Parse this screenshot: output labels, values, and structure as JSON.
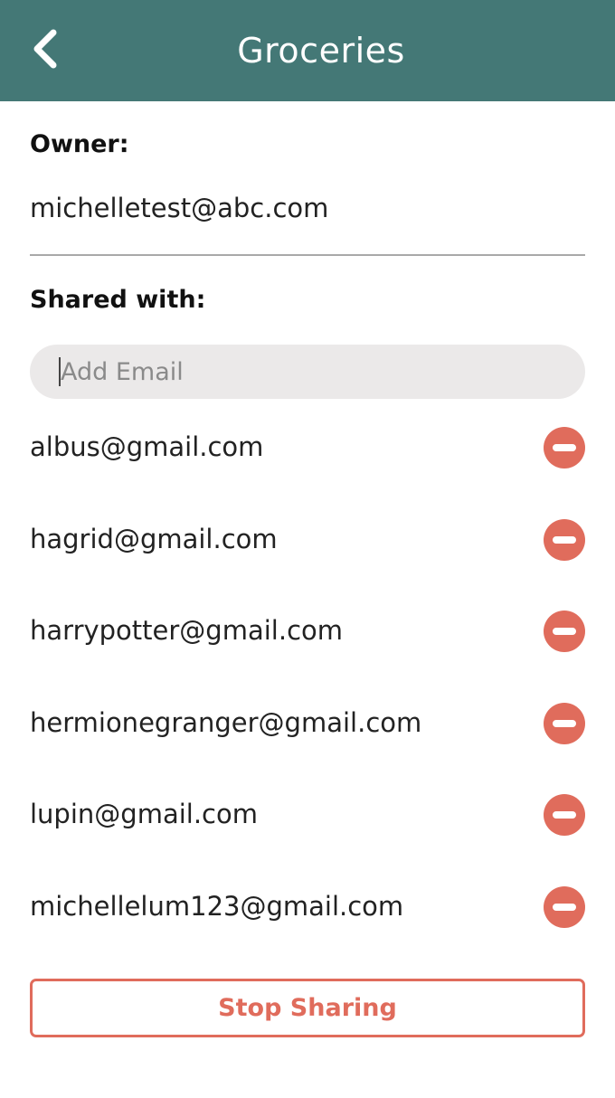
{
  "header": {
    "title": "Groceries",
    "back_icon": "chevron-left-icon",
    "background": "#447876"
  },
  "owner": {
    "label": "Owner:",
    "email": "michelletest@abc.com"
  },
  "shared": {
    "label": "Shared with:",
    "add_placeholder": "Add Email",
    "add_value": "",
    "remove_icon": "minus-circle-icon",
    "remove_color": "#e06c5c",
    "items": [
      {
        "email": "albus@gmail.com"
      },
      {
        "email": "hagrid@gmail.com"
      },
      {
        "email": "harrypotter@gmail.com"
      },
      {
        "email": "hermionegranger@gmail.com"
      },
      {
        "email": "lupin@gmail.com"
      },
      {
        "email": "michellelum123@gmail.com"
      }
    ]
  },
  "actions": {
    "stop_sharing_label": "Stop Sharing",
    "accent": "#e06c5c"
  }
}
